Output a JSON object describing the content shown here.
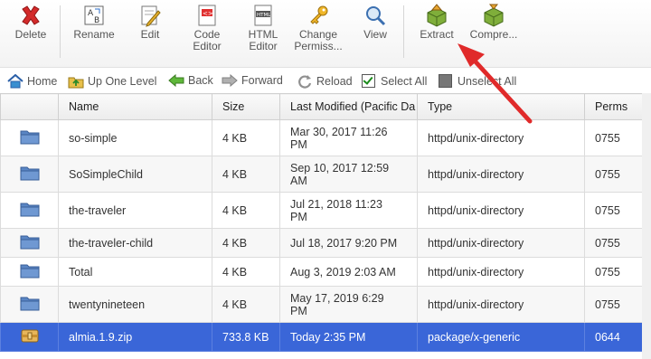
{
  "toolbar": {
    "delete": "Delete",
    "rename": "Rename",
    "edit": "Edit",
    "code_editor_1": "Code",
    "code_editor_2": "Editor",
    "html_editor_1": "HTML",
    "html_editor_2": "Editor",
    "change_perms_1": "Change",
    "change_perms_2": "Permiss...",
    "view": "View",
    "extract": "Extract",
    "compress": "Compre..."
  },
  "actionbar": {
    "home": "Home",
    "up_one_level": "Up One Level",
    "back": "Back",
    "forward": "Forward",
    "reload": "Reload",
    "select_all": "Select All",
    "unselect_all": "Unselect All"
  },
  "table": {
    "headers": {
      "name": "Name",
      "size": "Size",
      "modified": "Last Modified (Pacific Da",
      "type": "Type",
      "perms": "Perms"
    },
    "rows": [
      {
        "name": "so-simple",
        "size": "4 KB",
        "modified_1": "Mar 30, 2017 11:26",
        "modified_2": "PM",
        "type": "httpd/unix-directory",
        "perms": "0755",
        "icon": "folder-icon"
      },
      {
        "name": "SoSimpleChild",
        "size": "4 KB",
        "modified_1": "Sep 10, 2017 12:59",
        "modified_2": "AM",
        "type": "httpd/unix-directory",
        "perms": "0755",
        "icon": "folder-icon"
      },
      {
        "name": "the-traveler",
        "size": "4 KB",
        "modified_1": "Jul 21, 2018 11:23",
        "modified_2": "PM",
        "type": "httpd/unix-directory",
        "perms": "0755",
        "icon": "folder-icon"
      },
      {
        "name": "the-traveler-child",
        "size": "4 KB",
        "modified_1": "Jul 18, 2017 9:20 PM",
        "modified_2": "",
        "type": "httpd/unix-directory",
        "perms": "0755",
        "icon": "folder-icon"
      },
      {
        "name": "Total",
        "size": "4 KB",
        "modified_1": "Aug 3, 2019 2:03 AM",
        "modified_2": "",
        "type": "httpd/unix-directory",
        "perms": "0755",
        "icon": "folder-icon"
      },
      {
        "name": "twentynineteen",
        "size": "4 KB",
        "modified_1": "May 17, 2019 6:29",
        "modified_2": "PM",
        "type": "httpd/unix-directory",
        "perms": "0755",
        "icon": "folder-icon"
      },
      {
        "name": "almia.1.9.zip",
        "size": "733.8 KB",
        "modified_1": "Today 2:35 PM",
        "modified_2": "",
        "type": "package/x-generic",
        "perms": "0644",
        "icon": "archive-icon",
        "selected": true
      }
    ]
  },
  "colors": {
    "selected_row": "#3a66d8",
    "arrow": "#e02a2a"
  }
}
